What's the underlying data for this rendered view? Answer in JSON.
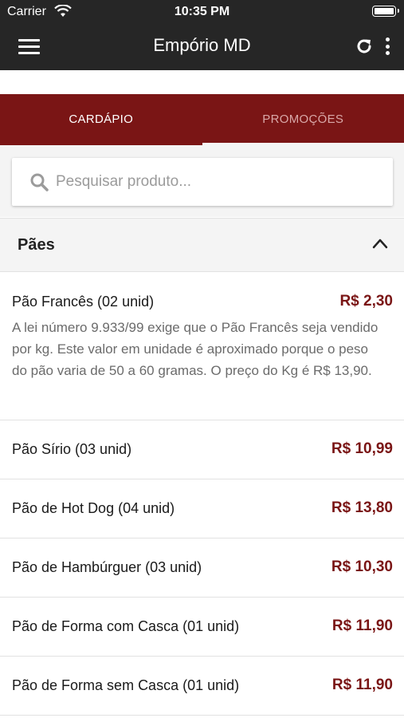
{
  "status_bar": {
    "carrier": "Carrier",
    "time": "10:35 PM"
  },
  "app_bar": {
    "title": "Empório MD",
    "icons": [
      "menu-icon",
      "refresh-icon",
      "more-vertical-icon"
    ]
  },
  "tabs": [
    {
      "label": "CARDÁPIO",
      "active": true
    },
    {
      "label": "PROMOÇÕES",
      "active": false
    }
  ],
  "search": {
    "placeholder": "Pesquisar produto...",
    "value": ""
  },
  "category": {
    "title": "Pães",
    "expanded": true
  },
  "products": [
    {
      "name": "Pão Francês (02 unid)",
      "price": "R$ 2,30",
      "description": "A lei número 9.933/99 exige que o Pão Francês seja vendido por kg. Este valor em unidade é aproximado porque o peso do pão varia de 50 a 60 gramas. O preço do Kg é R$ 13,90."
    },
    {
      "name": "Pão Sírio (03 unid)",
      "price": "R$ 10,99"
    },
    {
      "name": "Pão de Hot Dog (04 unid)",
      "price": "R$ 13,80"
    },
    {
      "name": "Pão de Hambúrguer (03 unid)",
      "price": "R$ 10,30"
    },
    {
      "name": "Pão de Forma com Casca (01 unid)",
      "price": "R$ 11,90"
    },
    {
      "name": "Pão de Forma sem Casca (01 unid)",
      "price": "R$ 11,90"
    }
  ],
  "colors": {
    "app_bar": "#262626",
    "tab_bar": "#7a1515",
    "price": "#7a1515"
  }
}
